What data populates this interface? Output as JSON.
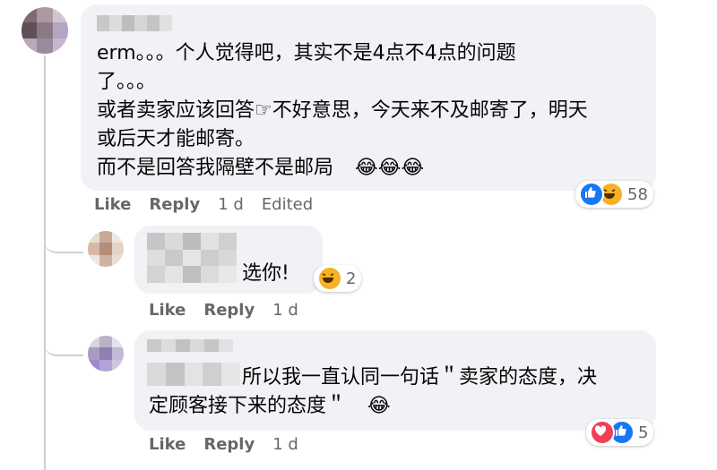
{
  "comments": [
    {
      "text": "erm。。。个人觉得吧，其实不是4点不4点的问题\n了。。。\n或者卖家应该回答☞不好意思，今天来不及邮寄了，明天\n或后天才能邮寄。\n而不是回答我隔壁不是邮局",
      "emoji": [
        "😂",
        "😂",
        "😂"
      ],
      "actions": {
        "like": "Like",
        "reply": "Reply",
        "time": "1 d",
        "edited": "Edited"
      },
      "reactions": {
        "icons": [
          "like-icon",
          "laugh-icon"
        ],
        "count": "58"
      }
    },
    {
      "text": "选你!",
      "actions": {
        "like": "Like",
        "reply": "Reply",
        "time": "1 d"
      },
      "reactions": {
        "icons": [
          "laugh-icon"
        ],
        "count": "2"
      }
    },
    {
      "text": "所以我一直认同一句话＂卖家的态度，决\n定顾客接下来的态度＂",
      "emoji": [
        "😂"
      ],
      "actions": {
        "like": "Like",
        "reply": "Reply",
        "time": "1 d"
      },
      "reactions": {
        "icons": [
          "love-icon",
          "like-icon"
        ],
        "count": "5"
      }
    }
  ],
  "colors": {
    "bubble": "#f0f2f5",
    "meta_text": "#65676b",
    "like_blue": "#1877f2",
    "love_red": "#f33e58",
    "haha_yellow": "#f7b125"
  }
}
